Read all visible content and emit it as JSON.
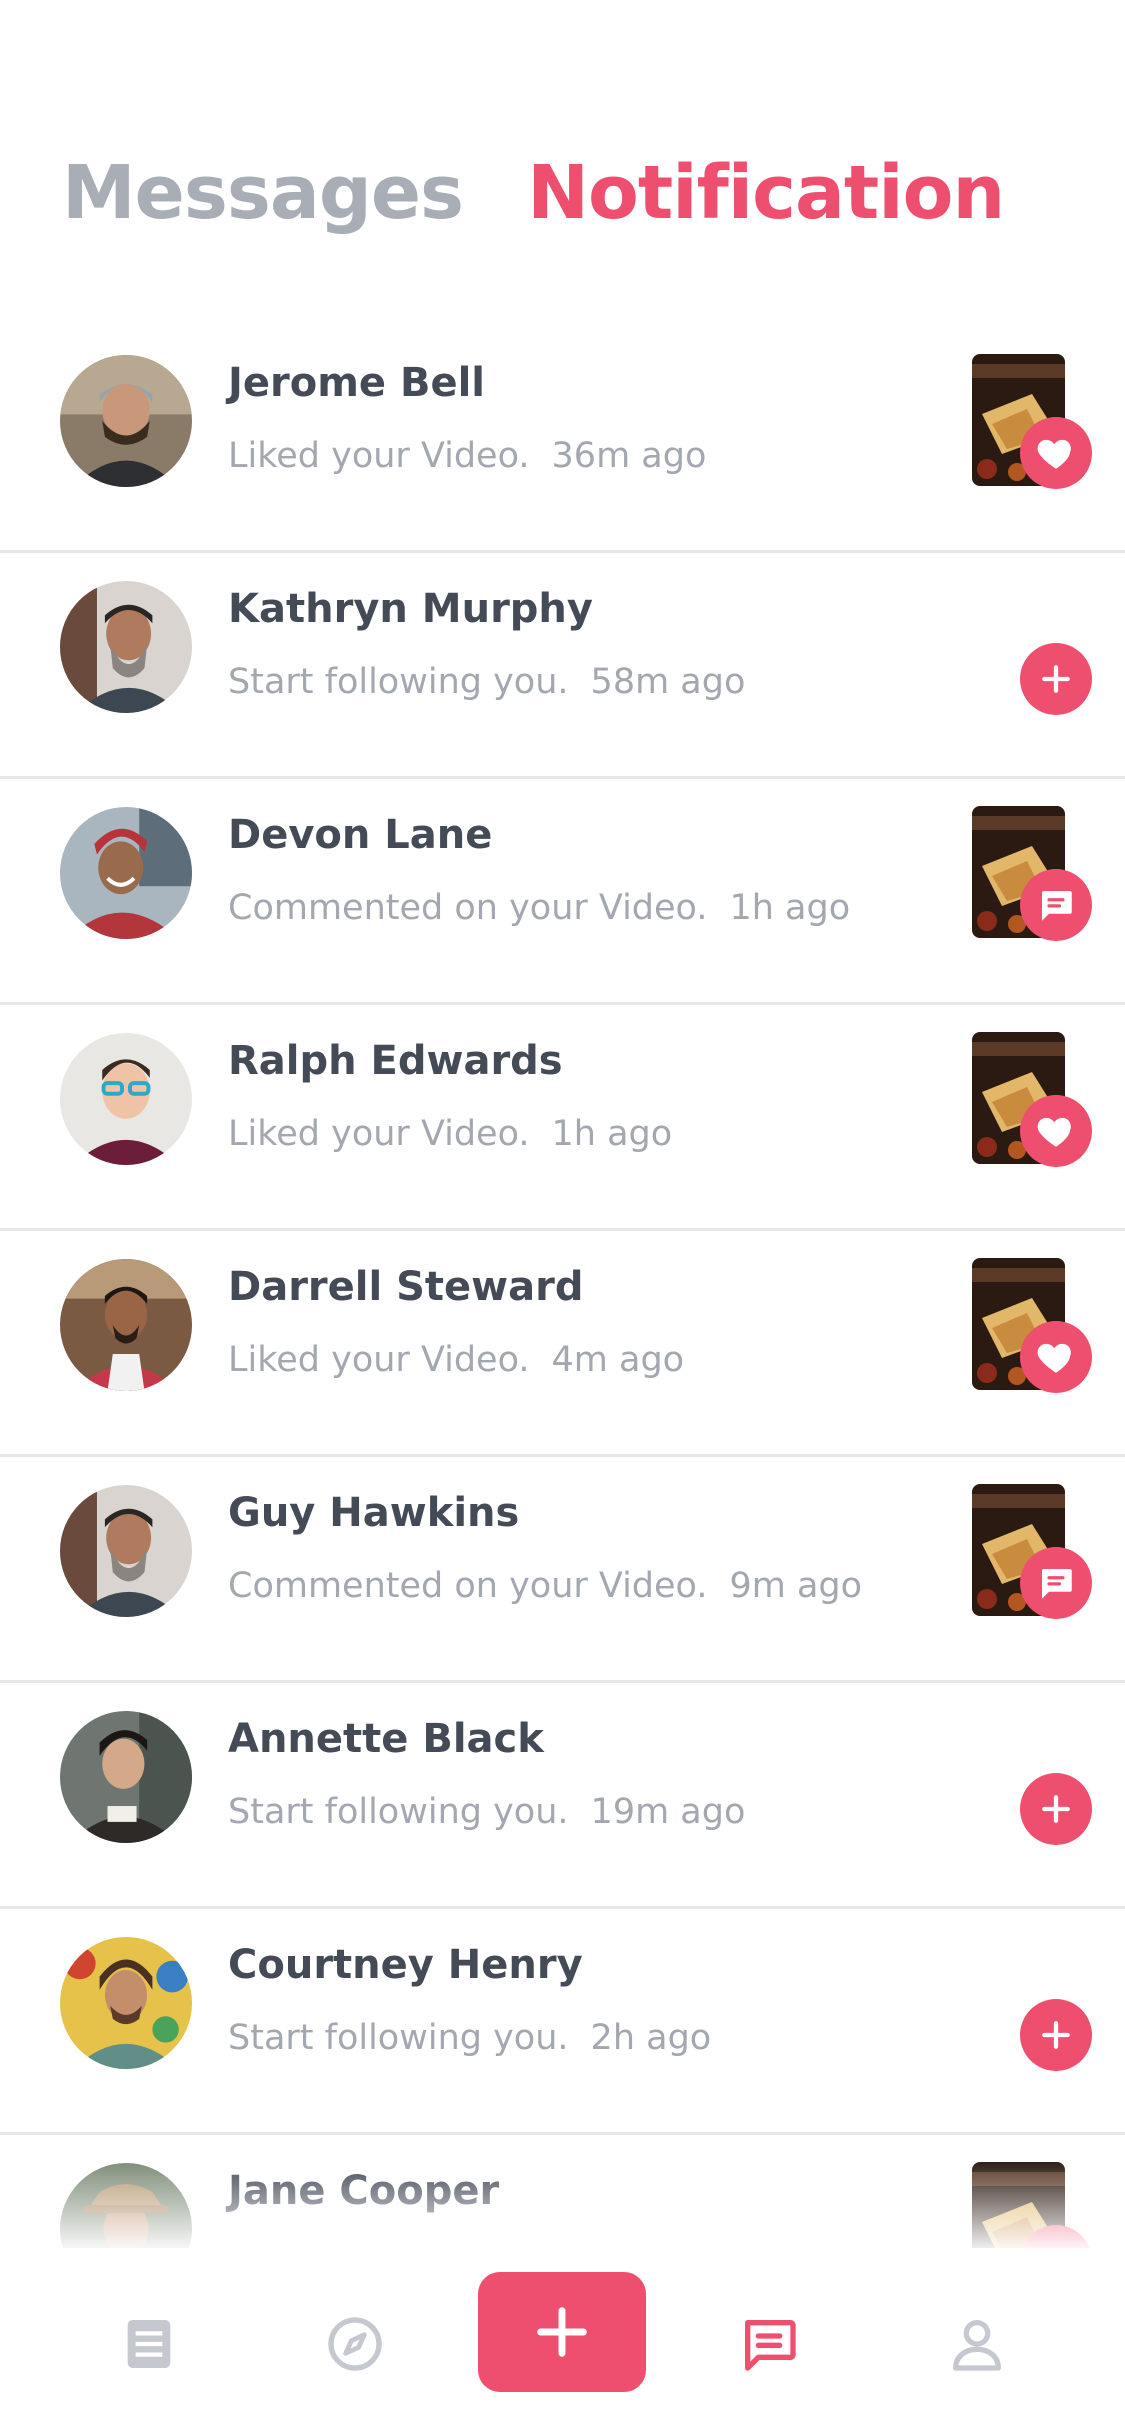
{
  "header": {
    "tabs": [
      {
        "label": "Messages",
        "active": false
      },
      {
        "label": "Notification",
        "active": true
      }
    ]
  },
  "notifications": [
    {
      "name": "Jerome Bell",
      "action": "Liked your Video.",
      "time": "36m ago",
      "type": "like"
    },
    {
      "name": "Kathryn Murphy",
      "action": "Start following you.",
      "time": "58m ago",
      "type": "follow"
    },
    {
      "name": "Devon Lane",
      "action": "Commented on your Video.",
      "time": "1h ago",
      "type": "comment"
    },
    {
      "name": "Ralph Edwards",
      "action": "Liked your Video.",
      "time": "1h ago",
      "type": "like"
    },
    {
      "name": "Darrell Steward",
      "action": "Liked your Video.",
      "time": "4m ago",
      "type": "like"
    },
    {
      "name": "Guy Hawkins",
      "action": "Commented on your Video.",
      "time": "9m ago",
      "type": "comment"
    },
    {
      "name": "Annette Black",
      "action": "Start following you.",
      "time": "19m ago",
      "type": "follow"
    },
    {
      "name": "Courtney Henry",
      "action": "Start following you.",
      "time": "2h ago",
      "type": "follow"
    },
    {
      "name": "Jane Cooper",
      "action": "",
      "time": "",
      "type": "like"
    }
  ],
  "tabbar": {
    "items": [
      {
        "icon": "feed-icon",
        "active": false
      },
      {
        "icon": "compass-icon",
        "active": false
      },
      {
        "icon": "plus-icon",
        "active": false
      },
      {
        "icon": "chat-icon",
        "active": true
      },
      {
        "icon": "profile-icon",
        "active": false
      }
    ]
  },
  "colors": {
    "accent": "#ef4f6e",
    "text_dark": "#454a57",
    "text_muted": "#a3a7b0",
    "tab_inactive": "#a9adb6",
    "icon_inactive": "#c5c8cf"
  }
}
